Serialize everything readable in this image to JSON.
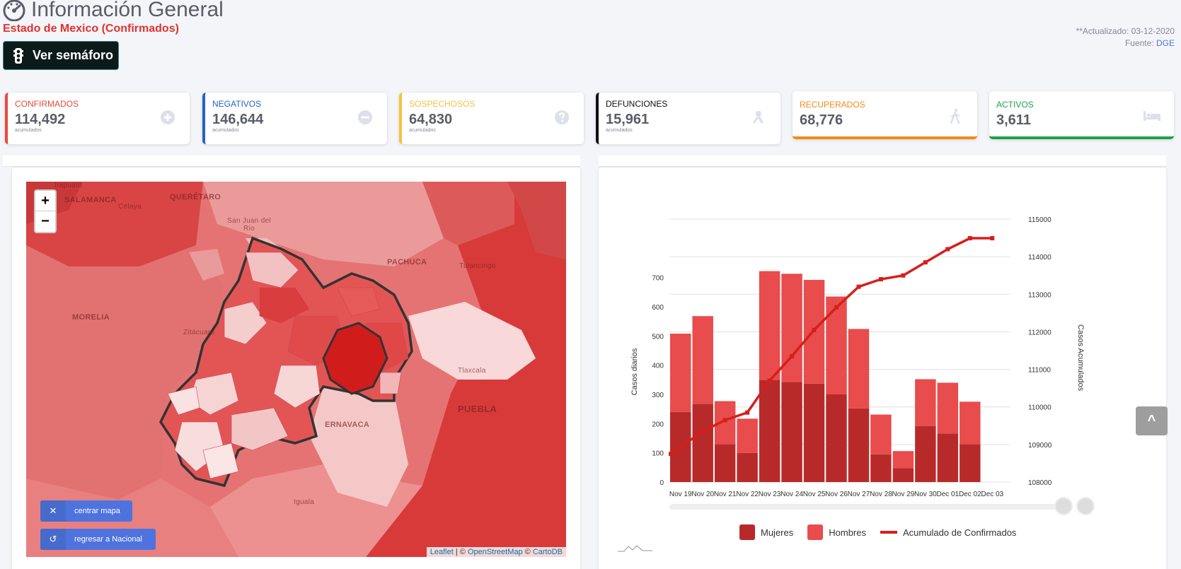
{
  "header": {
    "title": "Información General",
    "subtitle": "Estado de Mexico (Confirmados)",
    "updated": "**Actualizado: 03-12-2020",
    "source_prefix": "Fuente: ",
    "source_link": "DGE",
    "semaforo_button": "Ver semáforo"
  },
  "cards": [
    {
      "label": "CONFIRMADOS",
      "value": "114,492",
      "sub": "acumulados",
      "color": "#e74a3b",
      "icon": "plus-circle-icon"
    },
    {
      "label": "NEGATIVOS",
      "value": "146,644",
      "sub": "acumulados",
      "color": "#2463c8",
      "icon": "minus-circle-icon"
    },
    {
      "label": "SOSPECHOSOS",
      "value": "64,830",
      "sub": "acumulados",
      "color": "#f6c23e",
      "icon": "question-circle-icon"
    },
    {
      "label": "DEFUNCIONES",
      "value": "15,961",
      "sub": "acumulados",
      "color": "#111111",
      "icon": "ribbon-icon"
    },
    {
      "label": "RECUPERADOS",
      "value": "68,776",
      "color": "#f28b14",
      "icon": "walking-icon"
    },
    {
      "label": "ACTIVOS",
      "value": "3,611",
      "color": "#1aa34a",
      "icon": "bed-icon"
    }
  ],
  "map": {
    "zoom_in": "+",
    "zoom_out": "−",
    "center_button": "centrar mapa",
    "back_button": "regresar a Nacional",
    "attribution_leaflet": "Leaflet",
    "attribution_sep": " | © ",
    "attribution_osm": "OpenStreetMap",
    "attribution_sep2": " © ",
    "attribution_carto": "CartoDB",
    "labels": [
      {
        "text": "SALAMANCA",
        "kind": "big"
      },
      {
        "text": "Irapuato",
        "kind": "small"
      },
      {
        "text": "Celaya",
        "kind": "small"
      },
      {
        "text": "QUERÉTARO",
        "kind": "big"
      },
      {
        "text": "San Juan del Rio",
        "kind": "small"
      },
      {
        "text": "PACHUCA",
        "kind": "big"
      },
      {
        "text": "Tulancingo",
        "kind": "small"
      },
      {
        "text": "MORELIA",
        "kind": "big"
      },
      {
        "text": "Zitácuaro",
        "kind": "small"
      },
      {
        "text": "Tlaxcala",
        "kind": "small"
      },
      {
        "text": "PUEBLA",
        "kind": "big"
      },
      {
        "text": "ERNAVACA",
        "kind": "big"
      },
      {
        "text": "Iguala",
        "kind": "small"
      }
    ]
  },
  "chart_data": {
    "type": "bar",
    "categories": [
      "Nov 19",
      "Nov 20",
      "Nov 21",
      "Nov 22",
      "Nov 23",
      "Nov 24",
      "Nov 25",
      "Nov 26",
      "Nov 27",
      "Nov 28",
      "Nov 29",
      "Nov 30",
      "Dec 01",
      "Dec 02",
      "Dec 03"
    ],
    "stacked": true,
    "series": [
      {
        "name": "Mujeres",
        "kind": "bar",
        "color": "#b82a2a",
        "values": [
          240,
          268,
          130,
          100,
          350,
          343,
          337,
          300,
          252,
          95,
          48,
          192,
          166,
          130,
          0
        ]
      },
      {
        "name": "Hombres",
        "kind": "bar",
        "color": "#e84c4c",
        "values": [
          268,
          300,
          147,
          117,
          372,
          370,
          355,
          335,
          272,
          136,
          58,
          160,
          174,
          145,
          0
        ]
      },
      {
        "name": "Acumulado de Confirmados",
        "kind": "line",
        "axis": "right",
        "color": "#d61e1e",
        "values": [
          108750,
          109350,
          109650,
          109850,
          110700,
          111350,
          112050,
          112650,
          113200,
          113400,
          113500,
          113850,
          114200,
          114492,
          114492
        ]
      }
    ],
    "ylabel": "Casos diarios",
    "y2label": "Casos Acumulados",
    "ylim": [
      0,
      900
    ],
    "yticks": [
      0,
      100,
      200,
      300,
      400,
      500,
      600,
      700
    ],
    "y2lim": [
      108000,
      115000
    ],
    "y2ticks": [
      108000,
      109000,
      110000,
      111000,
      112000,
      113000,
      114000,
      115000
    ],
    "legend_position": "bottom",
    "grid": true
  },
  "scroll_top": "^"
}
